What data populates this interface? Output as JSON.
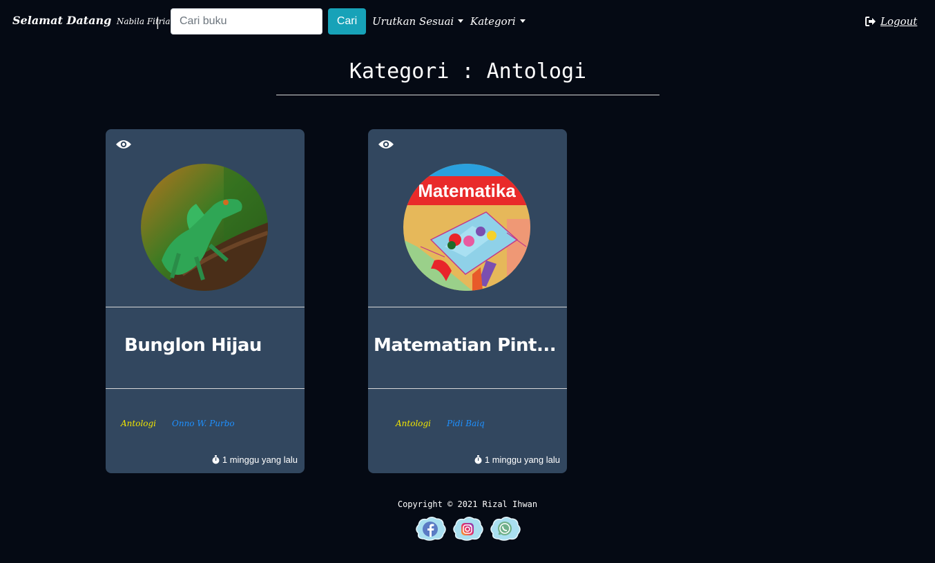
{
  "navbar": {
    "brand": "Selamat Datang",
    "brand_user": "Nabila Fitriani",
    "separator": "|",
    "search_placeholder": "Cari buku",
    "search_button": "Cari",
    "sort_label": "Urutkan Sesuai",
    "category_label": "Kategori",
    "logout_label": "Logout"
  },
  "page": {
    "title": "Kategori : Antologi"
  },
  "books": [
    {
      "title": "Bunglon Hijau",
      "category": "Antologi",
      "author": "Onno W. Purbo",
      "time": "1 minggu yang lalu"
    },
    {
      "title": "Matematian Pint...",
      "category": "Antologi",
      "author": "Pidi Baiq",
      "time": "1 minggu yang lalu",
      "cover_text": "Matematika"
    }
  ],
  "footer": {
    "copyright": "Copyright © 2021 Rizal Ihwan",
    "socials": [
      "facebook-icon",
      "instagram-icon",
      "whatsapp-icon"
    ]
  },
  "colors": {
    "background": "#050a14",
    "card": "#32475f",
    "search_button": "#17a2b8",
    "category": "#f2e600",
    "author": "#1e90ff"
  }
}
